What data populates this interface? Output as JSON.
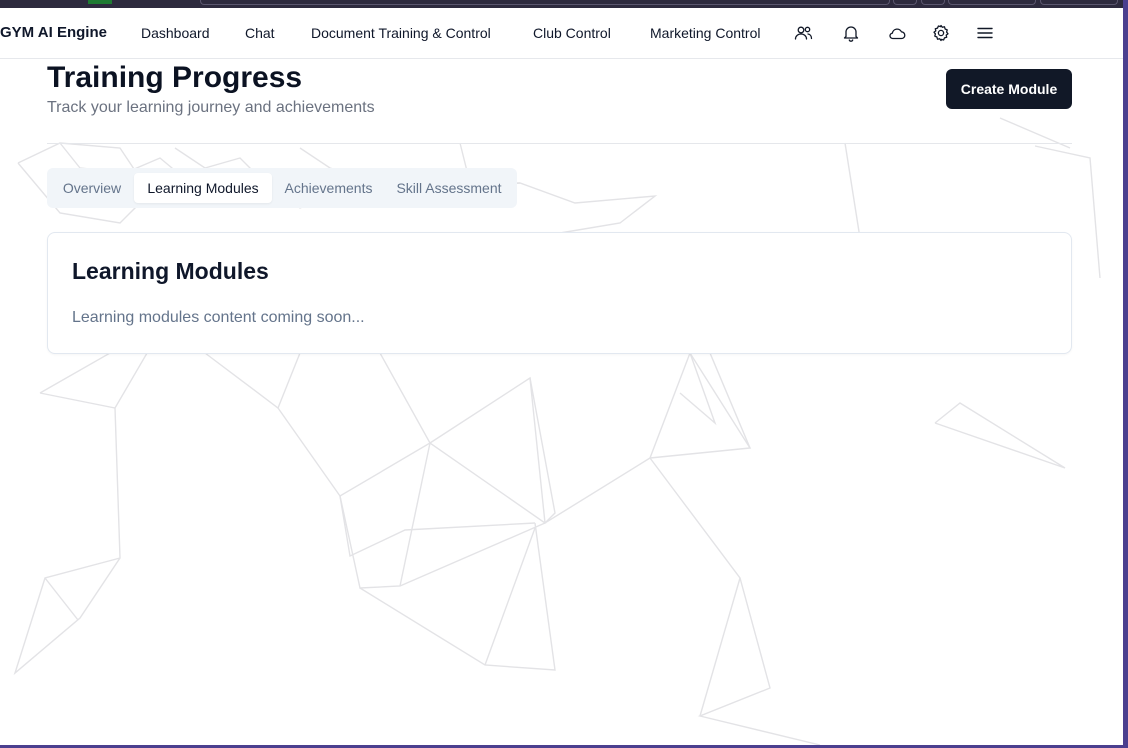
{
  "nav": {
    "brand": "GYM AI Engine",
    "items": [
      {
        "label": "Dashboard"
      },
      {
        "label": "Chat"
      },
      {
        "label": "Document Training & Control"
      },
      {
        "label": "Club Control"
      },
      {
        "label": "Marketing Control"
      }
    ],
    "icons": [
      "users-icon",
      "bell-icon",
      "cloud-icon",
      "gear-icon",
      "menu-icon"
    ]
  },
  "header": {
    "title": "Training Progress",
    "subtitle": "Track your learning journey and achievements",
    "create_label": "Create Module"
  },
  "tabs": [
    {
      "label": "Overview",
      "active": false
    },
    {
      "label": "Learning Modules",
      "active": true
    },
    {
      "label": "Achievements",
      "active": false
    },
    {
      "label": "Skill Assessment",
      "active": false
    }
  ],
  "card": {
    "title": "Learning Modules",
    "body": "Learning modules content coming soon..."
  },
  "colors": {
    "accent": "#111827",
    "frame": "#4b3f8f",
    "muted_text": "#64748b",
    "network_lines": "#e3e3e6"
  }
}
